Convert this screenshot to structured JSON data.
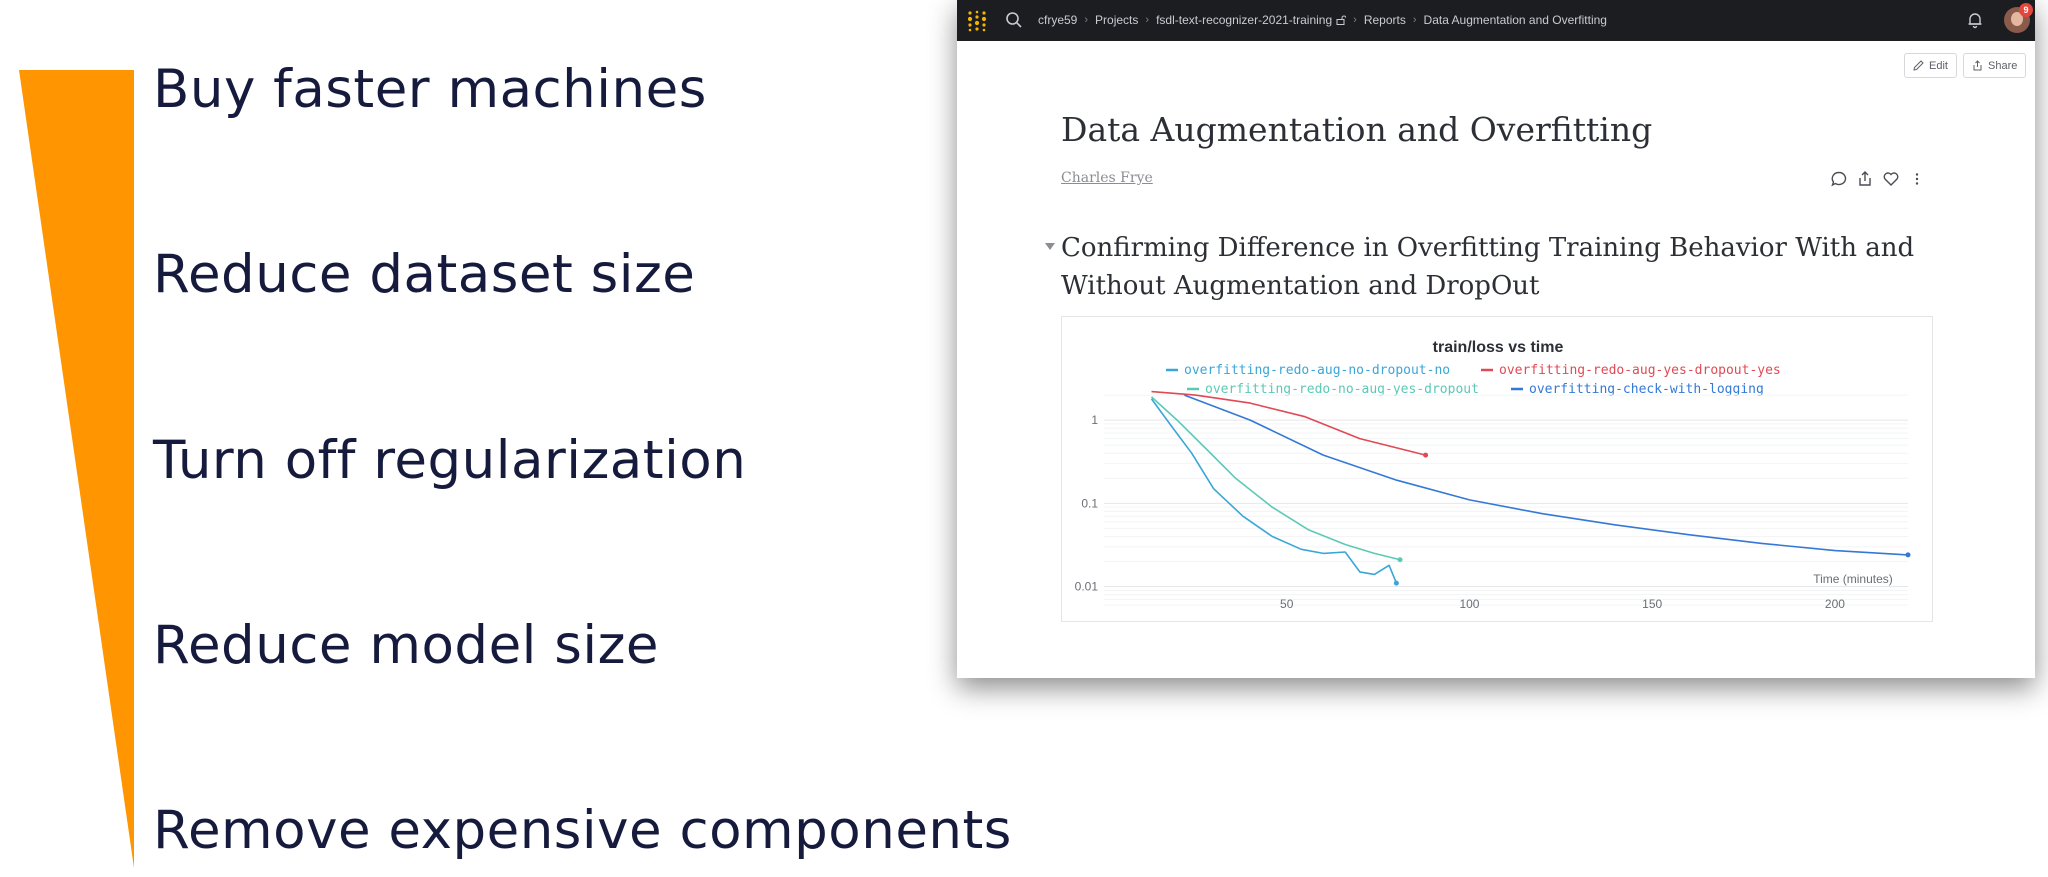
{
  "slide": {
    "accent_color": "#ff9500",
    "bullets": [
      "Buy faster machines",
      "Reduce dataset size",
      "Turn off regularization",
      "Reduce model size",
      "Remove expensive components"
    ]
  },
  "app": {
    "breadcrumbs": [
      "cfrye59",
      "Projects",
      "fsdl-text-recognizer-2021-training",
      "Reports",
      "Data Augmentation and Overfitting"
    ],
    "notification_count": "9",
    "edit_label": "Edit",
    "share_label": "Share",
    "report_title": "Data Augmentation and Overfitting",
    "author": "Charles Frye",
    "section_title": "Confirming Difference in Overfitting Training Behavior With and Without Augmentation and DropOut"
  },
  "chart_data": {
    "type": "line",
    "title": "train/loss vs time",
    "xlabel": "Time (minutes)",
    "ylabel": "",
    "yscale": "log",
    "xlim": [
      0,
      220
    ],
    "ylim": [
      0.006,
      2.5
    ],
    "xticks": [
      50,
      100,
      150,
      200
    ],
    "yticks": [
      {
        "value": 1,
        "label": "1"
      },
      {
        "value": 0.1,
        "label": "0.1"
      },
      {
        "value": 0.01,
        "label": "0.01"
      }
    ],
    "grid": true,
    "legend_position": "top",
    "series": [
      {
        "name": "overfitting-redo-aug-no-dropout-no",
        "color": "#3aa6d8",
        "x": [
          13,
          18,
          24,
          30,
          38,
          46,
          54,
          60,
          66,
          70,
          74,
          78,
          80
        ],
        "y": [
          1.8,
          0.9,
          0.4,
          0.15,
          0.07,
          0.04,
          0.028,
          0.025,
          0.026,
          0.015,
          0.014,
          0.018,
          0.011
        ]
      },
      {
        "name": "overfitting-redo-aug-yes-dropout-yes",
        "color": "#e04a54",
        "x": [
          13,
          25,
          40,
          55,
          70,
          88
        ],
        "y": [
          2.2,
          2.0,
          1.6,
          1.1,
          0.6,
          0.38
        ]
      },
      {
        "name": "overfitting-redo-no-aug-yes-dropout",
        "color": "#5cc9b6",
        "x": [
          13,
          20,
          28,
          36,
          46,
          56,
          66,
          74,
          81
        ],
        "y": [
          1.9,
          1.0,
          0.45,
          0.2,
          0.09,
          0.048,
          0.032,
          0.025,
          0.021
        ]
      },
      {
        "name": "overfitting-check-with-logging",
        "color": "#3479d6",
        "x": [
          22,
          40,
          60,
          80,
          100,
          120,
          140,
          160,
          180,
          200,
          220
        ],
        "y": [
          2.0,
          1.0,
          0.38,
          0.19,
          0.11,
          0.075,
          0.055,
          0.042,
          0.033,
          0.027,
          0.024
        ]
      }
    ]
  }
}
